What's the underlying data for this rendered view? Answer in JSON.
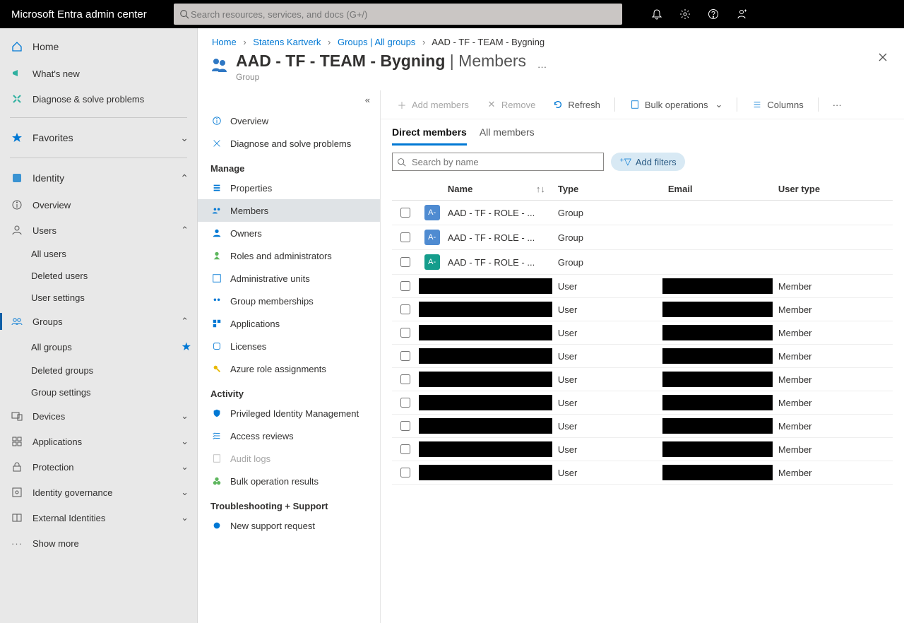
{
  "brand": "Microsoft Entra admin center",
  "search_placeholder": "Search resources, services, and docs (G+/)",
  "leftnav": {
    "home": "Home",
    "whatsnew": "What's new",
    "diagnose": "Diagnose & solve problems",
    "favorites": "Favorites",
    "identity": "Identity",
    "overview": "Overview",
    "users": "Users",
    "all_users": "All users",
    "deleted_users": "Deleted users",
    "user_settings": "User settings",
    "groups": "Groups",
    "all_groups": "All groups",
    "deleted_groups": "Deleted groups",
    "group_settings": "Group settings",
    "devices": "Devices",
    "applications": "Applications",
    "protection": "Protection",
    "identity_gov": "Identity governance",
    "ext_ident": "External Identities",
    "show_more": "Show more"
  },
  "breadcrumbs": [
    "Home",
    "Statens Kartverk",
    "Groups | All groups",
    "AAD - TF - TEAM - Bygning"
  ],
  "page": {
    "title_main": "AAD - TF - TEAM - Bygning",
    "title_sep": " | ",
    "title_sub": "Members",
    "subtitle": "Group"
  },
  "resmenu": {
    "overview": "Overview",
    "diagnose": "Diagnose and solve problems",
    "h_manage": "Manage",
    "properties": "Properties",
    "members": "Members",
    "owners": "Owners",
    "roles": "Roles and administrators",
    "admin_units": "Administrative units",
    "group_mem": "Group memberships",
    "apps": "Applications",
    "licenses": "Licenses",
    "azure_roles": "Azure role assignments",
    "h_activity": "Activity",
    "pim": "Privileged Identity Management",
    "access_rev": "Access reviews",
    "audit": "Audit logs",
    "bulk_res": "Bulk operation results",
    "h_trouble": "Troubleshooting + Support",
    "support": "New support request"
  },
  "cmdbar": {
    "add": "Add members",
    "remove": "Remove",
    "refresh": "Refresh",
    "bulk": "Bulk operations",
    "columns": "Columns"
  },
  "tabs": {
    "direct": "Direct members",
    "all": "All members"
  },
  "filters": {
    "search_ph": "Search by name",
    "add": "Add filters"
  },
  "columns": {
    "name": "Name",
    "type": "Type",
    "email": "Email",
    "user_type": "User type"
  },
  "rows": [
    {
      "avatar": "A-",
      "avcolor": "blue",
      "name": "AAD - TF - ROLE - ...",
      "type": "Group",
      "email": "",
      "user_type": "",
      "redact": false
    },
    {
      "avatar": "A-",
      "avcolor": "blue",
      "name": "AAD - TF - ROLE - ...",
      "type": "Group",
      "email": "",
      "user_type": "",
      "redact": false
    },
    {
      "avatar": "A-",
      "avcolor": "teal",
      "name": "AAD - TF - ROLE - ...",
      "type": "Group",
      "email": "",
      "user_type": "",
      "redact": false
    },
    {
      "type": "User",
      "user_type": "Member",
      "redact": true
    },
    {
      "type": "User",
      "user_type": "Member",
      "redact": true
    },
    {
      "type": "User",
      "user_type": "Member",
      "redact": true
    },
    {
      "type": "User",
      "user_type": "Member",
      "redact": true
    },
    {
      "type": "User",
      "user_type": "Member",
      "redact": true
    },
    {
      "type": "User",
      "user_type": "Member",
      "redact": true
    },
    {
      "type": "User",
      "user_type": "Member",
      "redact": true
    },
    {
      "type": "User",
      "user_type": "Member",
      "redact": true
    },
    {
      "type": "User",
      "user_type": "Member",
      "redact": true
    }
  ]
}
